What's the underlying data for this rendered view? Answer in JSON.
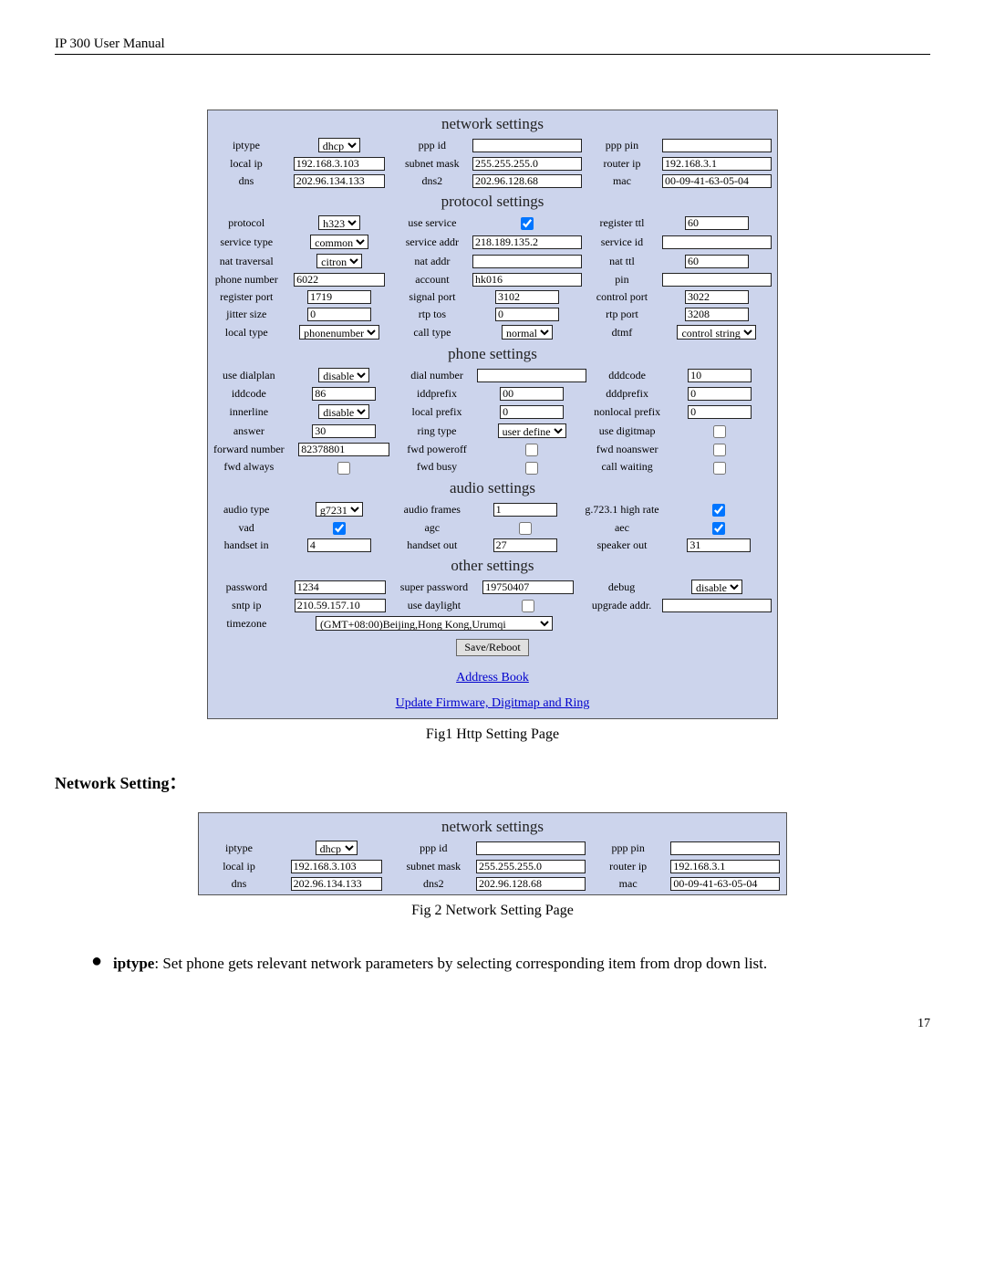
{
  "doc_header": "IP 300 User Manual",
  "page_number": "17",
  "fig1_caption": "Fig1 Http Setting Page",
  "fig2_caption": "Fig 2 Network Setting Page",
  "section_heading": "Network Setting：",
  "bullet_label": "iptype",
  "bullet_text": ": Set phone gets relevant network parameters by selecting corresponding item from drop down list.",
  "links": {
    "save": "Save/Reboot",
    "addr": "Address Book",
    "update": "Update Firmware, Digitmap and Ring"
  },
  "sect": {
    "network": "network settings",
    "protocol": "protocol settings",
    "phone": "phone settings",
    "audio": "audio settings",
    "other": "other settings"
  },
  "labels": {
    "iptype": "iptype",
    "pppid": "ppp id",
    "ppppin": "ppp pin",
    "localip": "local ip",
    "subnet": "subnet mask",
    "routerip": "router ip",
    "dns": "dns",
    "dns2": "dns2",
    "mac": "mac",
    "protocol": "protocol",
    "useservice": "use service",
    "registerttl": "register ttl",
    "servicetype": "service type",
    "serviceaddr": "service addr",
    "serviceid": "service id",
    "nattraversal": "nat traversal",
    "nataddr": "nat addr",
    "natttl": "nat ttl",
    "phonenumber": "phone number",
    "account": "account",
    "pin": "pin",
    "registerport": "register port",
    "signalport": "signal port",
    "controlport": "control port",
    "jittersize": "jitter size",
    "rtptos": "rtp tos",
    "rtpport": "rtp port",
    "localtype": "local type",
    "calltype": "call type",
    "dtmf": "dtmf",
    "usedialplan": "use dialplan",
    "dialnumber": "dial number",
    "dddcode": "dddcode",
    "iddcode": "iddcode",
    "iddprefix": "iddprefix",
    "dddprefix": "dddprefix",
    "innerline": "innerline",
    "localprefix": "local prefix",
    "nonlocalprefix": "nonlocal prefix",
    "answer": "answer",
    "ringtype": "ring type",
    "usedigitmap": "use digitmap",
    "forwardnumber": "forward number",
    "fwdpoweroff": "fwd poweroff",
    "fwdnoanswer": "fwd noanswer",
    "fwdalways": "fwd always",
    "fwdbusy": "fwd busy",
    "callwaiting": "call waiting",
    "audiotype": "audio type",
    "audioframes": "audio frames",
    "g7231": "g.723.1 high rate",
    "vad": "vad",
    "agc": "agc",
    "aec": "aec",
    "handsetin": "handset in",
    "handsetout": "handset out",
    "speakerout": "speaker out",
    "password": "password",
    "superpassword": "super password",
    "debug": "debug",
    "sntpip": "sntp ip",
    "usedaylight": "use daylight",
    "upgradeaddr": "upgrade addr.",
    "timezone": "timezone"
  },
  "values": {
    "iptype": "dhcp",
    "pppid": "",
    "ppppin": "",
    "localip": "192.168.3.103",
    "subnet": "255.255.255.0",
    "routerip": "192.168.3.1",
    "dns": "202.96.134.133",
    "dns2": "202.96.128.68",
    "mac": "00-09-41-63-05-04",
    "protocol": "h323",
    "registerttl": "60",
    "servicetype": "common",
    "serviceaddr": "218.189.135.2",
    "serviceid": "",
    "nattraversal": "citron",
    "nataddr": "",
    "natttl": "60",
    "phonenumber": "6022",
    "account": "hk016",
    "pin": "",
    "registerport": "1719",
    "signalport": "3102",
    "controlport": "3022",
    "jittersize": "0",
    "rtptos": "0",
    "rtpport": "3208",
    "localtype": "phonenumber",
    "calltype": "normal",
    "dtmf": "control string",
    "usedialplan": "disable",
    "dialnumber": "",
    "dddcode": "10",
    "iddcode": "86",
    "iddprefix": "00",
    "dddprefix": "0",
    "innerline": "disable",
    "localprefix": "0",
    "nonlocalprefix": "0",
    "answer": "30",
    "ringtype": "user define",
    "forwardnumber": "82378801",
    "audiotype": "g7231",
    "audioframes": "1",
    "handsetin": "4",
    "handsetout": "27",
    "speakerout": "31",
    "password": "1234",
    "superpassword": "19750407",
    "debug": "disable",
    "sntpip": "210.59.157.10",
    "upgradeaddr": "",
    "timezone": "(GMT+08:00)Beijing,Hong Kong,Urumqi"
  }
}
